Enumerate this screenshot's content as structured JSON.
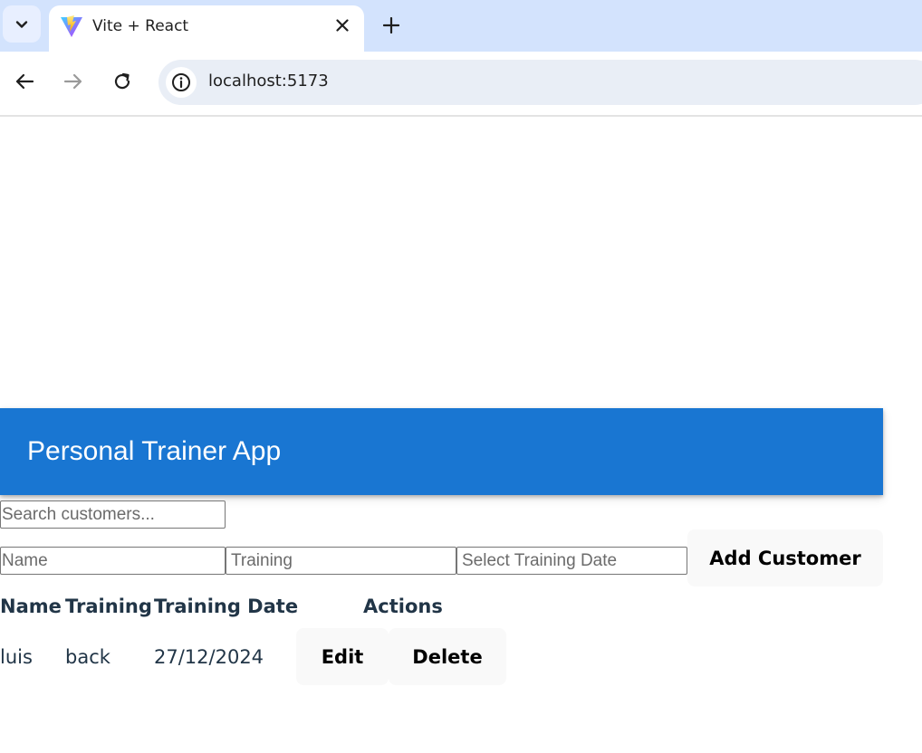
{
  "browser": {
    "tab_title": "Vite + React",
    "url": "localhost:5173",
    "icons": {
      "tab_search": "chevron-down-icon",
      "favicon": "vite-logo-icon",
      "tab_close": "close-icon",
      "new_tab": "plus-icon",
      "back": "arrow-left-icon",
      "forward": "arrow-right-icon",
      "reload": "reload-icon",
      "site_info": "info-icon"
    }
  },
  "app": {
    "title": "Personal Trainer App",
    "accent_color": "#1976d2",
    "search": {
      "placeholder": "Search customers...",
      "value": ""
    },
    "form": {
      "name_placeholder": "Name",
      "training_placeholder": "Training",
      "date_placeholder": "Select Training Date",
      "add_label": "Add Customer"
    },
    "table": {
      "headers": {
        "name": "Name",
        "training": "Training",
        "date": "Training Date",
        "actions": "Actions"
      },
      "rows": [
        {
          "name": "luis",
          "training": "back",
          "date": "27/12/2024",
          "edit_label": "Edit",
          "delete_label": "Delete"
        }
      ]
    }
  }
}
